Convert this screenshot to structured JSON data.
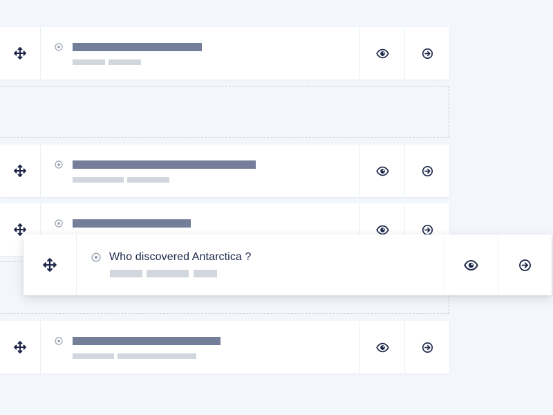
{
  "colors": {
    "background": "#f3f6fa",
    "card": "#ffffff",
    "title_placeholder": "#747e98",
    "meta_placeholder": "#d2d6dd",
    "icon": "#1c2547",
    "radio_icon": "#9aa1b1",
    "drop_slot_border": "#c9d0dc"
  },
  "icons": {
    "drag_handle": "move-icon",
    "status": "radio-icon",
    "preview": "eye-icon",
    "open": "arrow-right-circle-icon"
  },
  "dragged_item": {
    "question": "Who discovered Antarctica ?"
  }
}
